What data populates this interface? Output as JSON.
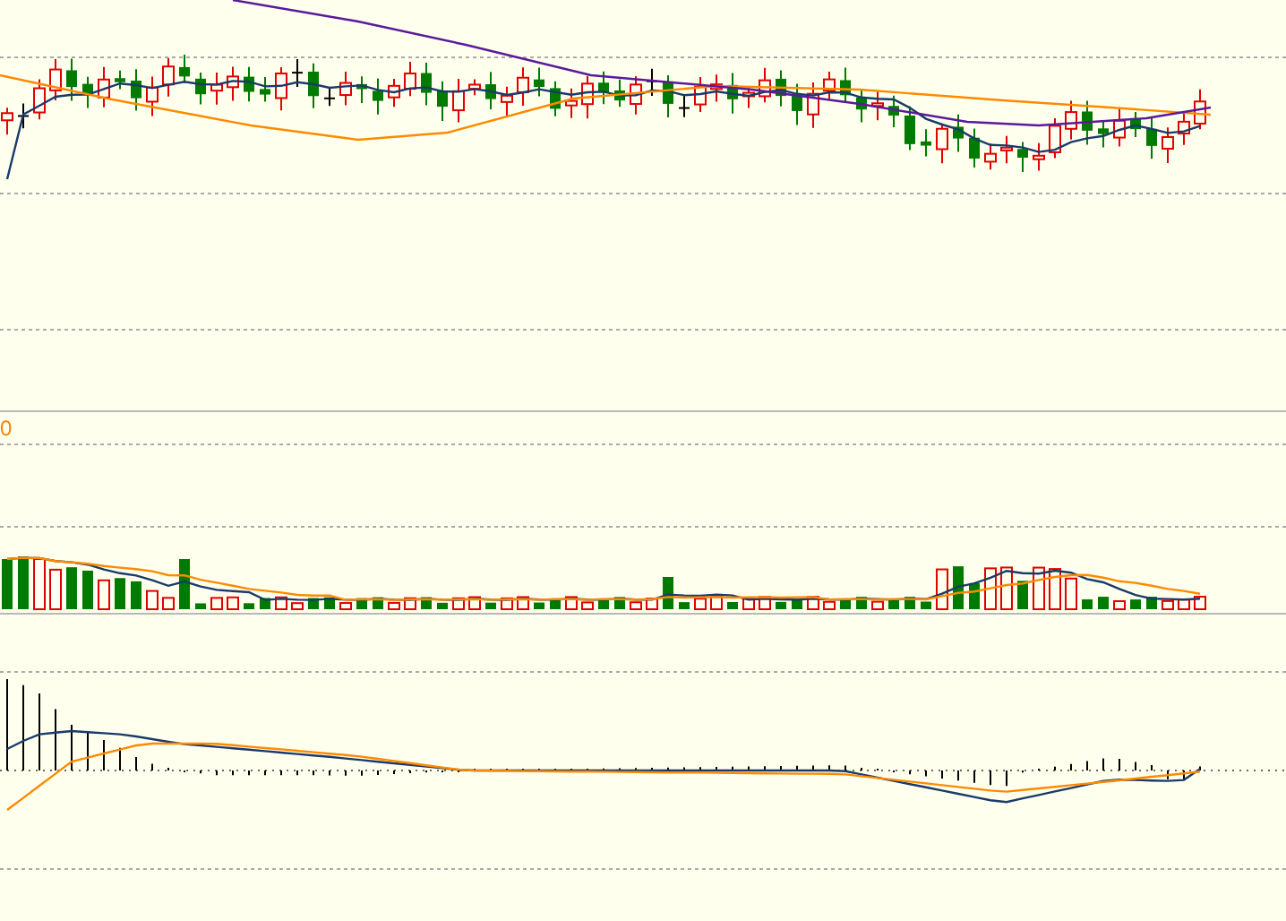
{
  "volume_panel": {
    "axis_label": "0"
  }
}
